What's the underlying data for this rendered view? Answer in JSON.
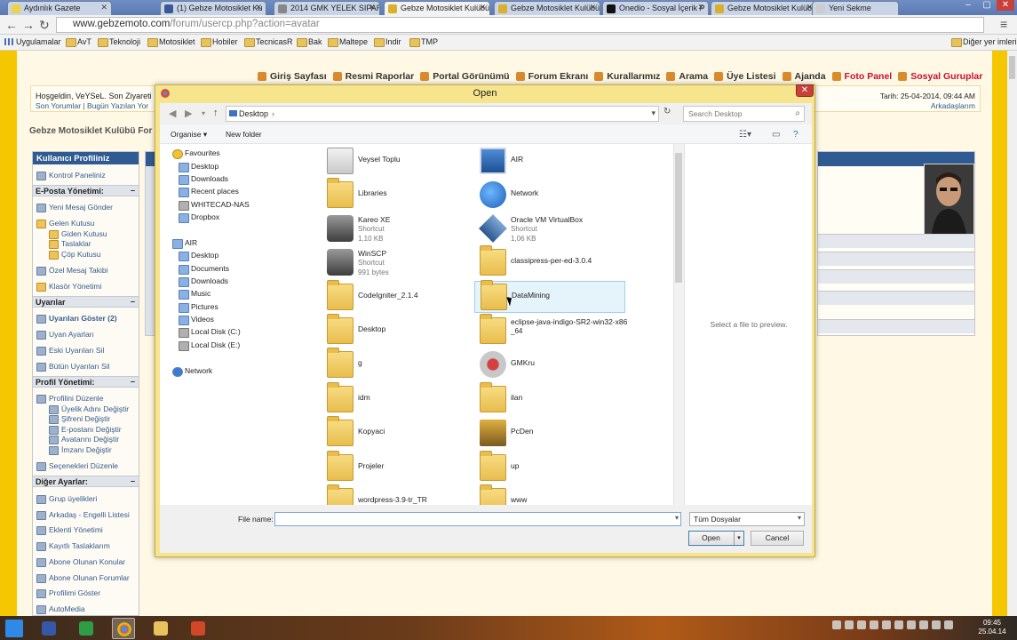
{
  "browser": {
    "tabs": [
      {
        "title": "Aydınlık Gazete",
        "color": "#e9d34a"
      },
      {
        "title": "(1) Gebze Motosiklet Ku",
        "color": "#3b5998"
      },
      {
        "title": "2014 GMK YELEK SIPARI",
        "color": "#888888"
      },
      {
        "title": "Gebze Motosiklet Kulübü",
        "color": "#d9b02b"
      },
      {
        "title": "Gebze Motosiklet Kulübü",
        "color": "#d9b02b"
      },
      {
        "title": "Onedio - Sosyal İçerik P",
        "color": "#111111"
      },
      {
        "title": "Gebze Motosiklet Kulübü",
        "color": "#d9b02b"
      },
      {
        "title": "Yeni Sekme",
        "color": "#cccccc"
      }
    ],
    "active_tab_index": 3,
    "url_host": "www.gebzemoto.com",
    "url_path": "/forum/usercp.php?action=avatar",
    "bookmarks": [
      "Uygulamalar",
      "AvT",
      "Teknoloji",
      "Motosiklet",
      "Hobiler",
      "TecnicasR",
      "Bak",
      "Maltepe",
      "Indir",
      "TMP"
    ],
    "other_bookmarks": "Diğer yer imleri"
  },
  "forum": {
    "top_menu": [
      "Giriş Sayfası",
      "Resmi Raporlar",
      "Portal Görünümü",
      "Forum Ekranı",
      "Kurallarımız",
      "Arama",
      "Üye Listesi",
      "Ajanda",
      "Foto Panel",
      "Sosyal Guruplar"
    ],
    "welcome": "Hoşgeldin, VeYSeL. Son Ziyareti",
    "links": "Son Yorumlar | Bugün Yazılan Yor",
    "date": "Tarih: 25-04-2014, 09:44 AM",
    "friends": "Arkadaşlarım",
    "site_title": "Gebze Motosiklet Kulübü For",
    "left_header": "Kullanıcı Profiliniz",
    "left": {
      "kontrol": "Kontrol Paneliniz",
      "eposta_header": "E-Posta Yönetimi:",
      "yeni_mesaj": "Yeni Mesaj Gönder",
      "gelen": "Gelen Kutusu",
      "giden": "Giden Kutusu",
      "taslak": "Taslaklar",
      "cop": "Çöp Kutusu",
      "ozel": "Özel Mesaj Takibi",
      "klasor": "Klasör Yönetimi",
      "uyari_header": "Uyarılar",
      "uyari_goster": "Uyarıları Göster (2)",
      "uyan": "Uyan Ayarları",
      "eski": "Eski Uyarıları Sil",
      "butun": "Bütün Uyarıları Sil",
      "profil_header": "Profil Yönetimi:",
      "profil_duzenle": "Profilini Düzenle",
      "uyelik": "Üyelik Adını Değiştir",
      "sifre": "Şifreni Değiştir",
      "eposta": "E-postanı Değiştir",
      "avatar": "Avatarını Değiştir",
      "imza": "İmzanı Değiştir",
      "secenek": "Seçenekleri Düzenle",
      "diger_header": "Diğer Ayarlar:",
      "grup": "Grup üyelikleri",
      "arkadas": "Arkadaş - Engelli Listesi",
      "eklenti": "Eklenti Yönetimi",
      "kayitli": "Kayıtlı Taslaklarım",
      "abone_konu": "Abone Olunan Konular",
      "abone_forum": "Abone Olunan Forumlar",
      "profil_goster": "Profilimi Göster",
      "automedia": "AutoMedia"
    }
  },
  "dialog": {
    "title": "Open",
    "close": "✕",
    "path": "Desktop",
    "search_placeholder": "Search Desktop",
    "organise": "Organise",
    "new_folder": "New folder",
    "nav": {
      "favourites": "Favourites",
      "fav_items": [
        "Desktop",
        "Downloads",
        "Recent places",
        "WHITECAD-NAS",
        "Dropbox"
      ],
      "computer": "AIR",
      "computer_items": [
        "Desktop",
        "Documents",
        "Downloads",
        "Music",
        "Pictures",
        "Videos",
        "Local Disk (C:)",
        "Local Disk (E:)"
      ],
      "network": "Network"
    },
    "files": [
      {
        "name": "Veysel Toplu",
        "icon": "user-folder-icon"
      },
      {
        "name": "AIR",
        "icon": "computer-icon"
      },
      {
        "name": "Libraries",
        "icon": "libraries-icon"
      },
      {
        "name": "Network",
        "icon": "network-icon"
      },
      {
        "name": "Kareo XE",
        "line2": "Shortcut",
        "line3": "1,10 KB",
        "icon": "shortcut-icon"
      },
      {
        "name": "Oracle VM VirtualBox",
        "line2": "Shortcut",
        "line3": "1,06 KB",
        "icon": "virtualbox-icon"
      },
      {
        "name": "WinSCP",
        "line2": "Shortcut",
        "line3": "991 bytes",
        "icon": "winscp-icon"
      },
      {
        "name": "classipress-per-ed-3.0.4",
        "icon": "folder-icon"
      },
      {
        "name": "CodeIgniter_2.1.4",
        "icon": "folder-icon"
      },
      {
        "name": "DataMining",
        "icon": "folder-icon",
        "selected": true
      },
      {
        "name": "Desktop",
        "icon": "folder-icon"
      },
      {
        "name": "eclipse-java-indigo-SR2-win32-x86",
        "name2": "_64",
        "icon": "folder-icon"
      },
      {
        "name": "g",
        "icon": "folder-icon"
      },
      {
        "name": "GMKru",
        "icon": "gmkru-icon"
      },
      {
        "name": "idm",
        "icon": "folder-icon"
      },
      {
        "name": "ilan",
        "icon": "folder-icon"
      },
      {
        "name": "Kopyaci",
        "icon": "folder-icon"
      },
      {
        "name": "PcDen",
        "icon": "pcden-icon"
      },
      {
        "name": "Projeler",
        "icon": "folder-icon"
      },
      {
        "name": "up",
        "icon": "folder-icon"
      },
      {
        "name": "wordpress-3.9-tr_TR",
        "icon": "folder-icon"
      },
      {
        "name": "www",
        "icon": "folder-icon"
      }
    ],
    "preview_text": "Select a file to preview.",
    "file_name_label": "File name:",
    "file_name_value": "",
    "filter": "Tüm Dosyalar",
    "open_button": "Open",
    "cancel_button": "Cancel"
  },
  "taskbar": {
    "time": "09:45",
    "date": "25.04.14"
  }
}
